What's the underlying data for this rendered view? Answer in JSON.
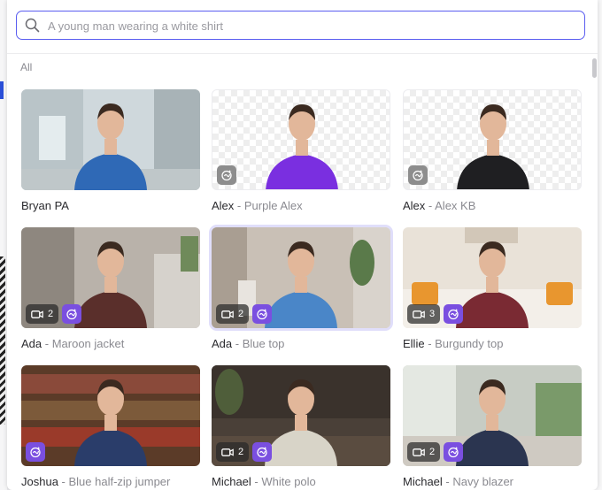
{
  "search": {
    "placeholder": "A young man wearing a white shirt",
    "value": ""
  },
  "section_label": "All",
  "separator": " - ",
  "colors": {
    "accent": "#5a5df0",
    "ai_badge": "#7a4fe0",
    "ai_badge_inactive": "#8d8d8d"
  },
  "avatars": [
    {
      "name": "Bryan PA",
      "look": "",
      "camera_count": null,
      "ai_badge": false,
      "transparent": false,
      "scene": "clinic",
      "shirt": "#2f69b6"
    },
    {
      "name": "Alex",
      "look": "Purple Alex",
      "camera_count": null,
      "ai_badge": "gray",
      "transparent": true,
      "scene": "cutout",
      "shirt": "#7a2fe0"
    },
    {
      "name": "Alex",
      "look": "Alex KB",
      "camera_count": null,
      "ai_badge": "gray",
      "transparent": true,
      "scene": "cutout",
      "shirt": "#1f1f22"
    },
    {
      "name": "Ada",
      "look": "Maroon jacket",
      "camera_count": "2",
      "ai_badge": true,
      "transparent": false,
      "scene": "lounge",
      "shirt": "#5a2f2b"
    },
    {
      "name": "Ada",
      "look": "Blue top",
      "camera_count": "2",
      "ai_badge": true,
      "transparent": false,
      "scene": "studio",
      "shirt": "#4a86c8",
      "selected": true
    },
    {
      "name": "Ellie",
      "look": "Burgundy top",
      "camera_count": "3",
      "ai_badge": true,
      "transparent": false,
      "scene": "sofa",
      "shirt": "#7a2a33"
    },
    {
      "name": "Joshua",
      "look": "Blue half-zip jumper",
      "camera_count": null,
      "ai_badge": true,
      "transparent": false,
      "scene": "library",
      "shirt": "#2a3d6a"
    },
    {
      "name": "Michael",
      "look": "White polo",
      "camera_count": "2",
      "ai_badge": true,
      "transparent": false,
      "scene": "dark",
      "shirt": "#d8d4c8"
    },
    {
      "name": "Michael",
      "look": "Navy blazer",
      "camera_count": "2",
      "ai_badge": true,
      "transparent": false,
      "scene": "office",
      "shirt": "#2b3550"
    }
  ]
}
